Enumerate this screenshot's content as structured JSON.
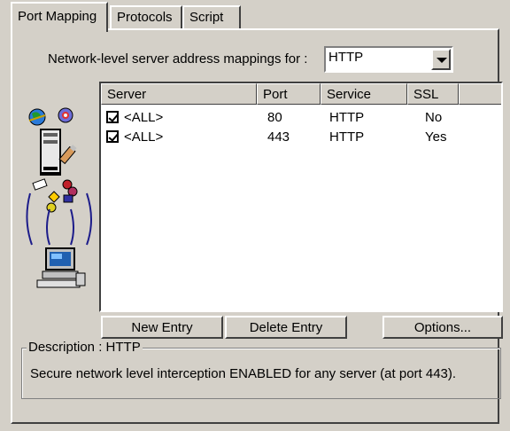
{
  "tabs": [
    {
      "label": "Port Mapping",
      "active": true
    },
    {
      "label": "Protocols",
      "active": false
    },
    {
      "label": "Script",
      "active": false
    }
  ],
  "mapping": {
    "label": "Network-level server address mappings for :",
    "protocol_value": "HTTP"
  },
  "table": {
    "columns": [
      "Server",
      "Port",
      "Service",
      "SSL"
    ],
    "rows": [
      {
        "checked": true,
        "server": "<ALL>",
        "port": "80",
        "service": "HTTP",
        "ssl": "No"
      },
      {
        "checked": true,
        "server": "<ALL>",
        "port": "443",
        "service": "HTTP",
        "ssl": "Yes"
      }
    ]
  },
  "buttons": {
    "new_entry": "New Entry",
    "delete_entry": "Delete Entry",
    "options": "Options..."
  },
  "description": {
    "legend": "Description : HTTP",
    "text": "Secure network level interception ENABLED for any server (at port 443)."
  },
  "icons": [
    "globe-icon",
    "gear-globe-icon",
    "server-tower-icon",
    "pencil-icon",
    "network-nodes-icon",
    "workstation-icon"
  ],
  "colors": {
    "dialog_bg": "#d4d0c8",
    "list_bg": "#ffffff"
  }
}
